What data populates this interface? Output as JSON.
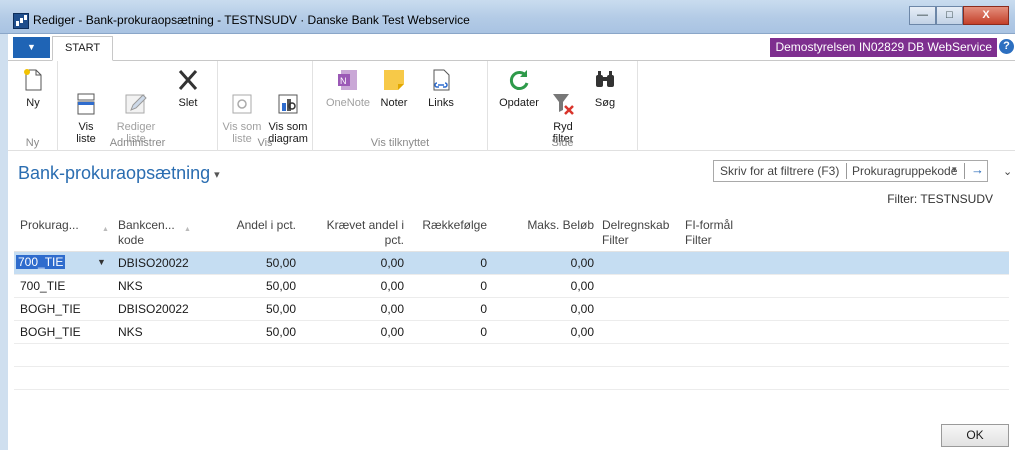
{
  "window": {
    "title": "Rediger - Bank-prokuraopsætning - TESTNSUDV · Danske Bank Test Webservice",
    "controls": {
      "minimize": "—",
      "maximize": "□",
      "close": "X"
    }
  },
  "tabs": {
    "menu": "▼",
    "start": "START"
  },
  "company": "Demostyrelsen IN02829 DB WebService",
  "help_icon": "?",
  "ribbon": {
    "groups": [
      {
        "label": "Ny",
        "buttons": [
          {
            "label": "Ny",
            "icon": "new-icon",
            "enabled": true
          }
        ]
      },
      {
        "label": "Administrer",
        "buttons": [
          {
            "label": "Vis\nliste",
            "icon": "view-list-icon",
            "enabled": true
          },
          {
            "label": "Rediger\nliste",
            "icon": "edit-list-icon",
            "enabled": false
          },
          {
            "label": "Slet",
            "icon": "delete-icon",
            "enabled": true
          }
        ]
      },
      {
        "label": "Vis",
        "buttons": [
          {
            "label": "Vis som\nliste",
            "icon": "view-as-list-icon",
            "enabled": false
          },
          {
            "label": "Vis som\ndiagram",
            "icon": "view-as-chart-icon",
            "enabled": true
          }
        ]
      },
      {
        "label": "Vis tilknyttet",
        "buttons": [
          {
            "label": "OneNote",
            "icon": "onenote-icon",
            "enabled": false
          },
          {
            "label": "Noter",
            "icon": "notes-icon",
            "enabled": true
          },
          {
            "label": "Links",
            "icon": "links-icon",
            "enabled": true
          }
        ]
      },
      {
        "label": "Side",
        "buttons": [
          {
            "label": "Opdater",
            "icon": "refresh-icon",
            "enabled": true
          },
          {
            "label": "Ryd\nfilter",
            "icon": "clear-filter-icon",
            "enabled": true
          },
          {
            "label": "Søg",
            "icon": "search-icon",
            "enabled": true
          }
        ]
      }
    ]
  },
  "page": {
    "title": "Bank-prokuraopsætning",
    "title_caret": "▾",
    "filter_placeholder": "Skriv for at filtrere (F3)",
    "filter_field": "Prokuragruppekode",
    "filter_dropdown": "▾",
    "filter_go": "→",
    "collapse": "⌄",
    "filter_text": "Filter: TESTNSUDV"
  },
  "table": {
    "columns": [
      "Prokurag...",
      "Bankcen...\nkode",
      "Andel i pct.",
      "Krævet andel i\npct.",
      "Rækkefølge",
      "Maks. Beløb",
      "Delregnskab\nFilter",
      "FI-formål\nFilter"
    ],
    "rows": [
      {
        "code": "700_TIE",
        "bank": "DBISO20022",
        "share": "50,00",
        "required": "0,00",
        "order": "0",
        "max": "0,00",
        "dept": "",
        "purpose": ""
      },
      {
        "code": "700_TIE",
        "bank": "NKS",
        "share": "50,00",
        "required": "0,00",
        "order": "0",
        "max": "0,00",
        "dept": "",
        "purpose": ""
      },
      {
        "code": "BOGH_TIE",
        "bank": "DBISO20022",
        "share": "50,00",
        "required": "0,00",
        "order": "0",
        "max": "0,00",
        "dept": "",
        "purpose": ""
      },
      {
        "code": "BOGH_TIE",
        "bank": "NKS",
        "share": "50,00",
        "required": "0,00",
        "order": "0",
        "max": "0,00",
        "dept": "",
        "purpose": ""
      }
    ],
    "selected_row": 0,
    "row_dropdown": "▼"
  },
  "ok_label": "OK"
}
